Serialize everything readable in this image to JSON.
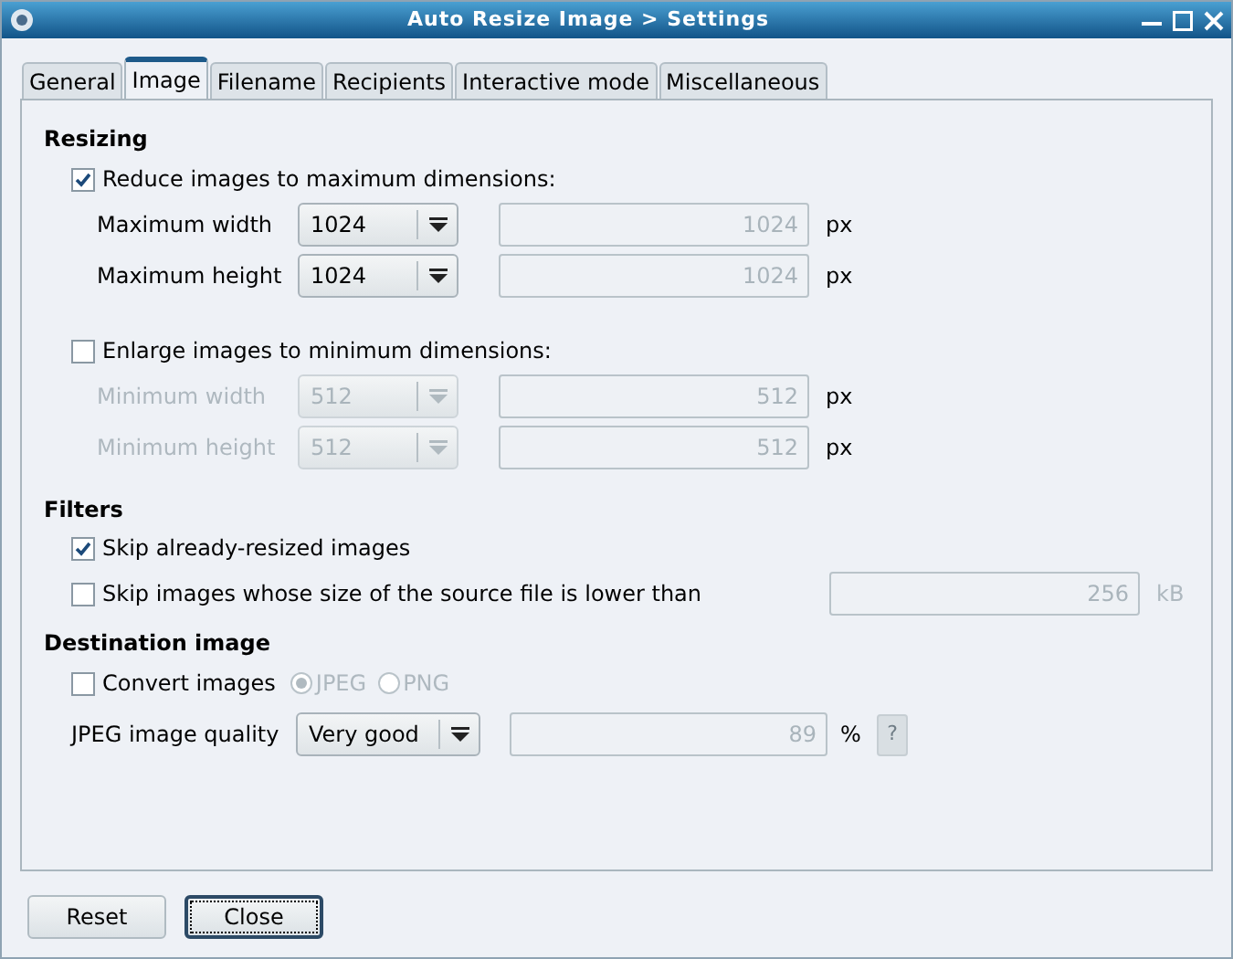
{
  "window": {
    "title": "Auto Resize Image > Settings"
  },
  "tabs": [
    {
      "label": "General",
      "selected": false
    },
    {
      "label": "Image",
      "selected": true
    },
    {
      "label": "Filename",
      "selected": false
    },
    {
      "label": "Recipients",
      "selected": false
    },
    {
      "label": "Interactive mode",
      "selected": false
    },
    {
      "label": "Miscellaneous",
      "selected": false
    }
  ],
  "resizing": {
    "heading": "Resizing",
    "groups": [
      {
        "label": "Reduce images to maximum dimensions:",
        "checked": true,
        "rows": [
          {
            "label": "Maximum width",
            "combo": "1024",
            "value": "1024",
            "unit": "px"
          },
          {
            "label": "Maximum height",
            "combo": "1024",
            "value": "1024",
            "unit": "px"
          }
        ]
      },
      {
        "label": "Enlarge images to minimum dimensions:",
        "checked": false,
        "rows": [
          {
            "label": "Minimum width",
            "combo": "512",
            "value": "512",
            "unit": "px"
          },
          {
            "label": "Minimum height",
            "combo": "512",
            "value": "512",
            "unit": "px"
          }
        ]
      }
    ]
  },
  "filters": {
    "heading": "Filters",
    "skip_resized": {
      "label": "Skip already-resized images",
      "checked": true
    },
    "skip_small": {
      "label": "Skip images whose size of the source file is lower than",
      "checked": false,
      "value": "256",
      "unit": "kB"
    }
  },
  "destination": {
    "heading": "Destination image",
    "convert": {
      "label": "Convert images",
      "checked": false
    },
    "formats": [
      {
        "label": "JPEG",
        "selected": true
      },
      {
        "label": "PNG",
        "selected": false
      }
    ],
    "quality": {
      "label": "JPEG image quality",
      "combo": "Very good",
      "value": "89",
      "unit": "%",
      "help": "?"
    }
  },
  "buttons": [
    {
      "label": "Reset",
      "focused": false
    },
    {
      "label": "Close",
      "focused": true
    }
  ]
}
